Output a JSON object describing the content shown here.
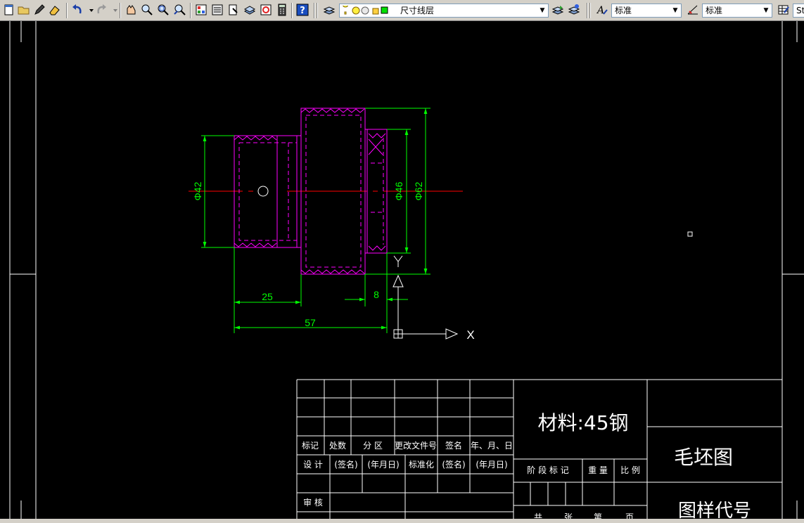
{
  "toolbar": {
    "layer_name": "尺寸线层",
    "text_style": "标准",
    "dim_style": "标准",
    "table_style_partial": "St",
    "icons": [
      "new-icon",
      "open-icon",
      "pen-icon",
      "eraser-icon",
      "undo-icon",
      "redo-icon",
      "pan-icon",
      "zoom-realtime-icon",
      "zoom-window-icon",
      "zoom-previous-icon",
      "properties-icon",
      "design-center-icon",
      "tool-palette-icon",
      "sheet-set-icon",
      "markup-icon",
      "calculator-icon",
      "help-icon",
      "layer-manager-icon",
      "layer-previous-icon",
      "layer-state-icon",
      "text-style-icon",
      "dim-style-icon",
      "table-style-icon"
    ]
  },
  "drawing": {
    "dim_phi42": "Φ42",
    "dim_phi46": "Φ46",
    "dim_phi62": "Φ62",
    "dim_25": "25",
    "dim_8": "8",
    "dim_57": "57",
    "ucs_x": "X",
    "ucs_y": "Y"
  },
  "title_block": {
    "material": "材料:45钢",
    "drawing_name": "毛坯图",
    "drawing_code": "图样代号",
    "row_headers": [
      "标记",
      "处数",
      "分 区",
      "更改文件号",
      "签名",
      "年、月、日"
    ],
    "design": "设 计",
    "sign1": "(签名)",
    "date1": "(年月日)",
    "standardize": "标准化",
    "sign2": "(签名)",
    "date2": "(年月日)",
    "review": "审 核",
    "stage_mark": "阶 段 标 记",
    "weight": "重 量",
    "scale": "比 例",
    "bottom_partial_1": "共",
    "bottom_partial_2": "张",
    "bottom_partial_3": "第",
    "bottom_partial_4": "页"
  },
  "colors": {
    "canvas": "#000000",
    "magenta": "#ff00ff",
    "green": "#00ff00",
    "red": "#ff0000",
    "white": "#ffffff"
  }
}
